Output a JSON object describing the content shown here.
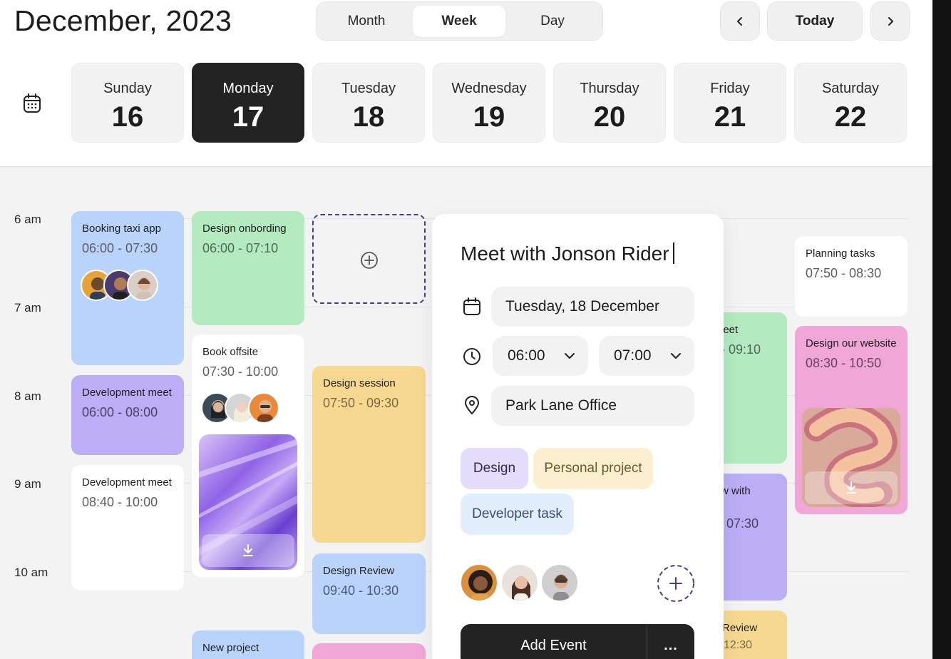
{
  "header": {
    "title": "December, 2023",
    "views": [
      "Month",
      "Week",
      "Day"
    ],
    "active_view": "Week",
    "prev_icon": "chevron-left-icon",
    "next_icon": "chevron-right-icon",
    "today_label": "Today"
  },
  "days": [
    {
      "name": "Sunday",
      "date": "16"
    },
    {
      "name": "Monday",
      "date": "17"
    },
    {
      "name": "Tuesday",
      "date": "18"
    },
    {
      "name": "Wednesday",
      "date": "19"
    },
    {
      "name": "Thursday",
      "date": "20"
    },
    {
      "name": "Friday",
      "date": "21"
    },
    {
      "name": "Saturday",
      "date": "22"
    }
  ],
  "times": [
    "6 am",
    "7 am",
    "8 am",
    "9 am",
    "10 am"
  ],
  "events": {
    "booking": {
      "title": "Booking taxi app",
      "time": "06:00 - 07:30"
    },
    "devmeet1": {
      "title": "Development meet",
      "time": "06:00 - 08:00"
    },
    "devmeet2": {
      "title": "Development meet",
      "time": "08:40 - 10:00"
    },
    "onboarding": {
      "title": "Design onbording",
      "time": "06:00 - 07:10"
    },
    "offsite": {
      "title": "Book offsite",
      "time": "07:30 - 10:00"
    },
    "newproject": {
      "title": "New project"
    },
    "session": {
      "title": "Design session",
      "time": "07:50 - 09:30"
    },
    "review": {
      "title": "Design Review",
      "time": "09:40 - 10:30"
    },
    "fri_meet": {
      "title": "leet",
      "time": "- 09:10"
    },
    "fri_with": {
      "title": "w with",
      "time": "07:30"
    },
    "fri_review": {
      "title": "Review",
      "time": "12:30"
    },
    "planning": {
      "title": "Planning tasks",
      "time": "07:50 - 08:30"
    },
    "website": {
      "title": "Design our website",
      "time": "08:30 - 10:50"
    }
  },
  "popup": {
    "title": "Meet with Jonson Rider",
    "date": "Tuesday, 18 December",
    "start_time": "06:00",
    "end_time": "07:00",
    "location": "Park Lane Office",
    "tags": [
      "Design",
      "Personal project",
      "Developer task"
    ],
    "submit_label": "Add Event",
    "more_label": "..."
  },
  "colors": {
    "blue": "#b9d3fb",
    "purple": "#bcaef6",
    "green": "#b3eac0",
    "yellow": "#f6d891",
    "pink": "#f0a6d6",
    "dark": "#232323",
    "accent_dashed": "#4c3b8c"
  }
}
